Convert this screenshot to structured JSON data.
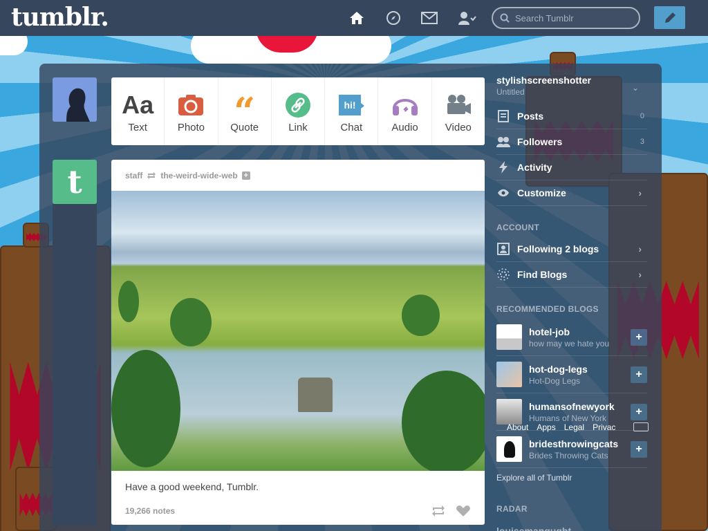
{
  "topbar": {
    "logo": "tumblr.",
    "search_placeholder": "Search Tumblr",
    "icons": [
      "home-icon",
      "explore-icon",
      "inbox-icon",
      "account-icon",
      "compose-icon"
    ],
    "accent": "#36465d"
  },
  "post_types": [
    {
      "label": "Text",
      "glyph": "Aa",
      "color": "#444444"
    },
    {
      "label": "Photo",
      "color": "#d95e40"
    },
    {
      "label": "Quote",
      "color": "#f2992e"
    },
    {
      "label": "Link",
      "color": "#56bc8a"
    },
    {
      "label": "Chat",
      "color": "#529ecc"
    },
    {
      "label": "Audio",
      "color": "#a77dc2"
    },
    {
      "label": "Video",
      "color": "#748089"
    }
  ],
  "post": {
    "author": "staff",
    "reblogged_from": "the-weird-wide-web",
    "caption": "Have a good weekend, Tumblr.",
    "notes": "19,266 notes"
  },
  "sidebar": {
    "blog_name": "stylishscreenshotter",
    "blog_subtitle": "Untitled",
    "items": [
      {
        "label": "Posts",
        "count": "0",
        "icon": "posts-icon"
      },
      {
        "label": "Followers",
        "count": "3",
        "icon": "followers-icon"
      },
      {
        "label": "Activity",
        "icon": "activity-icon"
      },
      {
        "label": "Customize",
        "icon": "eye-icon"
      }
    ],
    "account_heading": "ACCOUNT",
    "account_items": [
      {
        "label": "Following 2 blogs",
        "icon": "following-icon"
      },
      {
        "label": "Find Blogs",
        "icon": "find-blogs-icon"
      }
    ],
    "recommended_heading": "RECOMMENDED BLOGS",
    "recommended": [
      {
        "name": "hotel-job",
        "desc": "how may we hate you"
      },
      {
        "name": "hot-dog-legs",
        "desc": "Hot-Dog Legs"
      },
      {
        "name": "humansofnewyork",
        "desc": "Humans of New York"
      },
      {
        "name": "bridesthrowingcats",
        "desc": "Brides Throwing Cats"
      }
    ],
    "footer_links": [
      "About",
      "Apps",
      "Legal",
      "Privac"
    ],
    "explore": "Explore all of Tumblr",
    "radar_heading": "RADAR",
    "radar_item": "louisemangught"
  }
}
